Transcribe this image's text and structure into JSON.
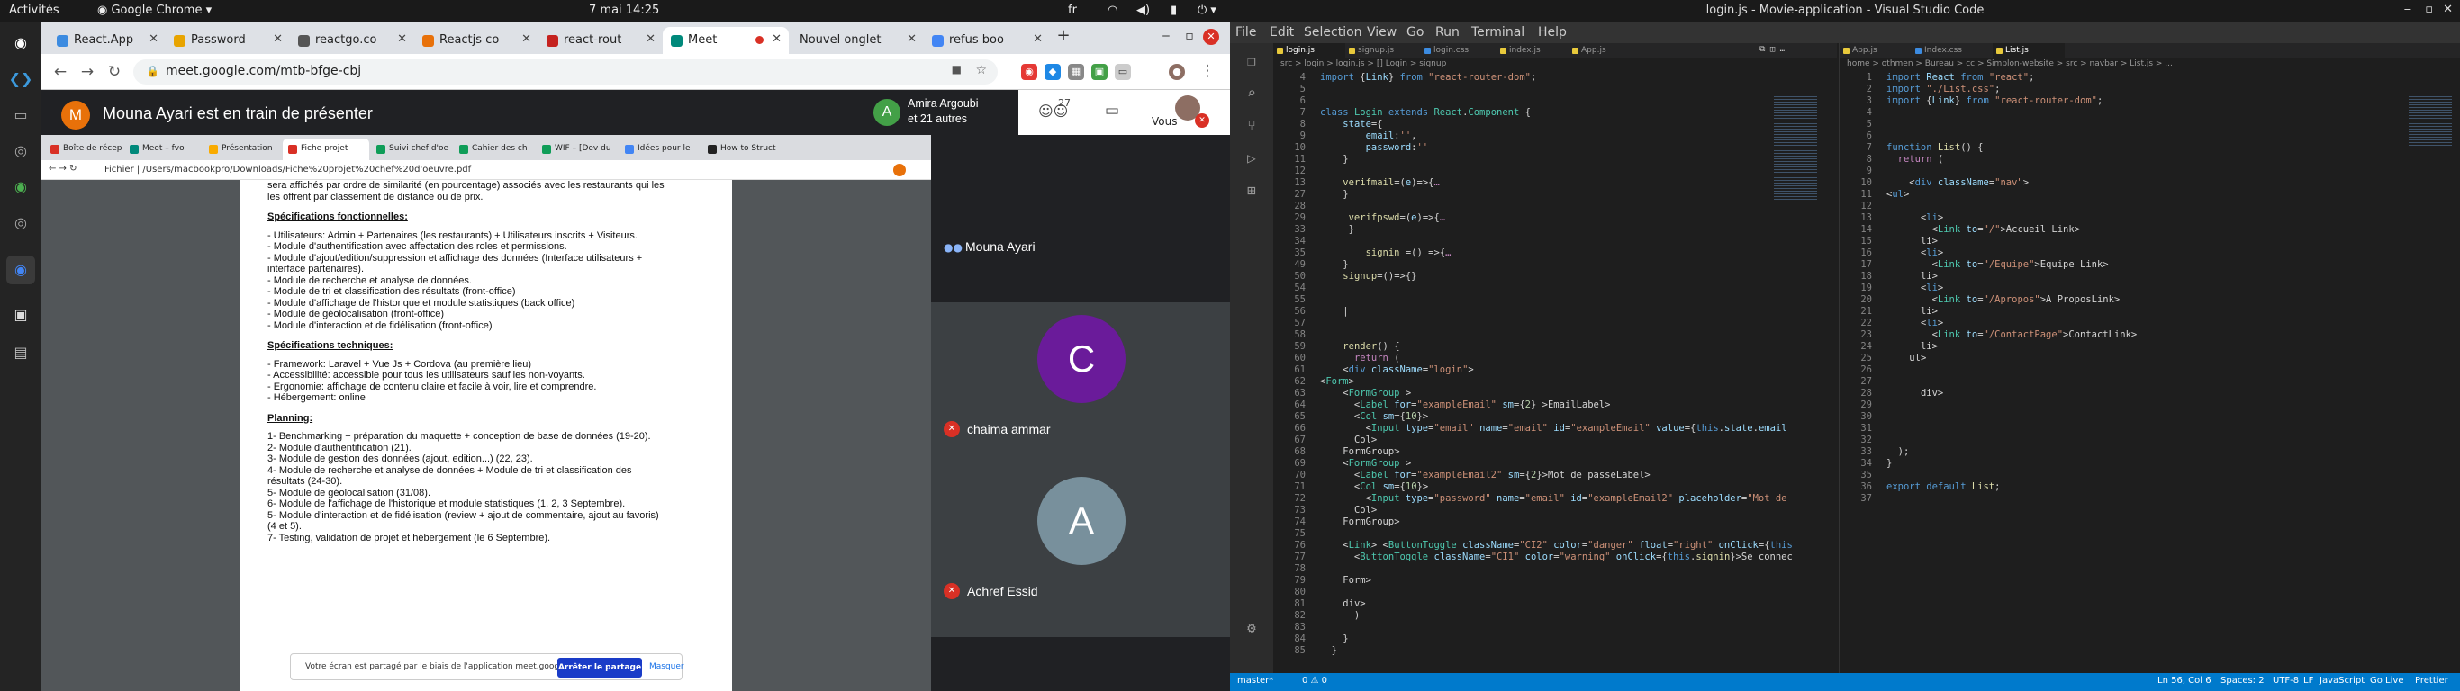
{
  "left": {
    "topbar": {
      "activities": "Activités",
      "app": "Google Chrome",
      "clock": "7 mai  14:25",
      "lang": "fr"
    },
    "tabs": [
      {
        "label": "React.App",
        "color": "#3c8be0"
      },
      {
        "label": "Password",
        "color": "#e8a400"
      },
      {
        "label": "reactgo.co",
        "color": "#555555"
      },
      {
        "label": "Reactjs co",
        "color": "#e8710a"
      },
      {
        "label": "react-rout",
        "color": "#c5221f"
      },
      {
        "label": "Meet –",
        "color": "#00897b"
      },
      {
        "label": "Nouvel onglet",
        "color": "#dee1e6"
      },
      {
        "label": "refus boo",
        "color": "#4285f4"
      }
    ],
    "url": "meet.google.com/mtb-bfge-cbj",
    "meet": {
      "presenter_initial": "M",
      "presenter_banner": "Mouna Ayari est en train de présenter",
      "viewer_initial": "A",
      "viewer_name": "Amira Argoubi",
      "viewer_others": "et 21 autres",
      "participants_count": "27",
      "you_label": "Vous"
    },
    "inner_tabs": [
      "Boîte de récep",
      "Meet – fvo",
      "Présentation",
      "Fiche projet",
      "Suivi chef d'oe",
      "Cahier des ch",
      "WIF – [Dev du",
      "Idées pour le",
      "How to Struct"
    ],
    "inner_url": "Fichier  |  /Users/macbookpro/Downloads/Fiche%20projet%20chef%20d'oeuvre.pdf",
    "pdf": {
      "intro": [
        "sera affichés par ordre de similarité (en pourcentage) associés avec les restaurants qui les",
        "les offrent par classement de distance ou de prix."
      ],
      "spec_fonc_title": "Spécifications fonctionnelles:",
      "spec_fonc": [
        "- Utilisateurs: Admin + Partenaires (les restaurants) + Utilisateurs inscrits + Visiteurs.",
        "- Module d'authentification avec affectation des roles et permissions.",
        "- Module d'ajout/edition/suppression et affichage des données (Interface utilisateurs +",
        "interface partenaires).",
        "- Module de recherche et analyse de données.",
        "- Module de tri et classification des résultats (front-office)",
        "- Module d'affichage de l'historique et module statistiques (back office)",
        "- Module de géolocalisation (front-office)",
        "- Module d'interaction et de fidélisation (front-office)"
      ],
      "spec_tech_title": "Spécifications techniques:",
      "spec_tech": [
        "- Framework: Laravel + Vue Js + Cordova (au première lieu)",
        "- Accessibilité: accessible pour tous les utilisateurs sauf les non-voyants.",
        "- Ergonomie: affichage de contenu claire et facile à voir, lire et comprendre.",
        "- Hébergement: online"
      ],
      "planning_title": "Planning:",
      "planning": [
        "1- Benchmarking + préparation du maquette + conception de base de données (19-20).",
        "2- Module d'authentification (21).",
        "3- Module de gestion des données (ajout, edition...) (22, 23).",
        "4- Module de recherche et analyse de données + Module de tri et classification des",
        "résultats (24-30).",
        "5- Module de géolocalisation (31/08).",
        "6- Module de l'affichage de l'historique et module statistiques (1, 2, 3 Septembre).",
        "5- Module d'interaction et de fidélisation (review + ajout de commentaire, ajout au favoris)",
        "(4 et 5).",
        "7- Testing, validation de projet et hébergement (le 6 Septembre)."
      ],
      "share_text": "Votre écran est partagé par le biais de l'application meet.google.com.",
      "stop_label": "Arrêter le partage",
      "hide_label": "Masquer"
    },
    "participants": [
      {
        "name": "Mouna Ayari",
        "initial": "",
        "color": ""
      },
      {
        "name": "chaima ammar",
        "initial": "C",
        "color": "#6a1b9a"
      },
      {
        "name": "Achref Essid",
        "initial": "A",
        "color": "#78909c"
      }
    ]
  },
  "right": {
    "title": "login.js - Movie-application - Visual Studio Code",
    "menu": [
      "File",
      "Edit",
      "Selection",
      "View",
      "Go",
      "Run",
      "Terminal",
      "Help"
    ],
    "left_tabs": [
      {
        "label": "login.js",
        "color": "#e8c93b"
      },
      {
        "label": "signup.js",
        "color": "#e8c93b"
      },
      {
        "label": "login.css",
        "color": "#3c8be0"
      },
      {
        "label": "index.js",
        "color": "#e8c93b"
      },
      {
        "label": "App.js",
        "color": "#e8c93b"
      }
    ],
    "left_breadcrumb": "src > login > login.js > [] Login > signup",
    "right_tabs": [
      {
        "label": "App.js",
        "color": "#e8c93b"
      },
      {
        "label": "Index.css",
        "color": "#3c8be0"
      },
      {
        "label": "List.js",
        "color": "#e8c93b"
      }
    ],
    "right_breadcrumb": "home > othmen > Bureau > cc > Simplon-website > src > navbar > List.js > ...",
    "left_code": [
      {
        "n": "4",
        "h": "<span class=k>import</span> {<span class=v>Link</span>} <span class=k>from</span> <span class=s>\"react-router-dom\"</span>;"
      },
      {
        "n": "5",
        "h": ""
      },
      {
        "n": "6",
        "h": ""
      },
      {
        "n": "7",
        "h": "<span class=k>class</span> <span class=t>Login</span> <span class=k>extends</span> <span class=t>React</span>.<span class=t>Component</span> {"
      },
      {
        "n": "8",
        "h": "    <span class=v>state</span>={"
      },
      {
        "n": "9",
        "h": "        <span class=v>email</span>:<span class=s>''</span>,"
      },
      {
        "n": "10",
        "h": "        <span class=v>password</span>:<span class=s>''</span>"
      },
      {
        "n": "11",
        "h": "    }"
      },
      {
        "n": "12",
        "h": ""
      },
      {
        "n": "13",
        "h": "    <span class=f>verifmail</span>=(<span class=v>e</span>)=>{<span class=p>…</span>"
      },
      {
        "n": "27",
        "h": "    }"
      },
      {
        "n": "28",
        "h": ""
      },
      {
        "n": "29",
        "h": "     <span class=f>verifpswd</span>=(<span class=v>e</span>)=>{<span class=p>…</span>"
      },
      {
        "n": "33",
        "h": "     }"
      },
      {
        "n": "34",
        "h": ""
      },
      {
        "n": "35",
        "h": "        <span class=f>signin</span> =() =>{<span class=p>…</span>"
      },
      {
        "n": "49",
        "h": "    }"
      },
      {
        "n": "50",
        "h": "    <span class=f>signup</span>=()=>{}"
      },
      {
        "n": "54",
        "h": ""
      },
      {
        "n": "55",
        "h": ""
      },
      {
        "n": "56",
        "h": "    |"
      },
      {
        "n": "57",
        "h": ""
      },
      {
        "n": "58",
        "h": ""
      },
      {
        "n": "59",
        "h": "    <span class=f>render</span>() {"
      },
      {
        "n": "60",
        "h": "      <span class=p>return</span> ("
      },
      {
        "n": "61",
        "h": "    <<span class=tg>div</span> <span class=ta>className</span>=<span class=s>\"login\"</span>>"
      },
      {
        "n": "62",
        "h": "<<span class=t>Form</span>>"
      },
      {
        "n": "63",
        "h": "    <<span class=t>FormGroup</span> >"
      },
      {
        "n": "64",
        "h": "      <<span class=t>Label</span> <span class=ta>for</span>=<span class=s>\"exampleEmail\"</span> <span class=ta>sm</span>={<span class=n>2</span>} >Email</<span class=t>Label</span>>"
      },
      {
        "n": "65",
        "h": "      <<span class=t>Col</span> <span class=ta>sm</span>={<span class=n>10</span>}>"
      },
      {
        "n": "66",
        "h": "        <<span class=t>Input</span> <span class=ta>type</span>=<span class=s>\"email\"</span> <span class=ta>name</span>=<span class=s>\"email\"</span> <span class=ta>id</span>=<span class=s>\"exampleEmail\"</span> <span class=ta>value</span>={<span class=k>this</span>.<span class=v>state</span>.<span class=v>email</span>"
      },
      {
        "n": "67",
        "h": "      </<span class=t>Col</span>>"
      },
      {
        "n": "68",
        "h": "    </<span class=t>FormGroup</span>>"
      },
      {
        "n": "69",
        "h": "    <<span class=t>FormGroup</span> >"
      },
      {
        "n": "70",
        "h": "      <<span class=t>Label</span> <span class=ta>for</span>=<span class=s>\"exampleEmail2\"</span> <span class=ta>sm</span>={<span class=n>2</span>}>Mot de passe</<span class=t>Label</span>>"
      },
      {
        "n": "71",
        "h": "      <<span class=t>Col</span> <span class=ta>sm</span>={<span class=n>10</span>}>"
      },
      {
        "n": "72",
        "h": "        <<span class=t>Input</span> <span class=ta>type</span>=<span class=s>\"password\"</span> <span class=ta>name</span>=<span class=s>\"email\"</span> <span class=ta>id</span>=<span class=s>\"exampleEmail2\"</span> <span class=ta>placeholder</span>=<span class=s>\"Mot de</span>"
      },
      {
        "n": "73",
        "h": "      </<span class=t>Col</span>>"
      },
      {
        "n": "74",
        "h": "    </<span class=t>FormGroup</span>>"
      },
      {
        "n": "75",
        "h": ""
      },
      {
        "n": "76",
        "h": "    <<span class=t>Link</span>> <<span class=t>ButtonToggle</span> <span class=ta>className</span>=<span class=s>\"CI2\"</span> <span class=ta>color</span>=<span class=s>\"danger\"</span> <span class=ta>float</span>=<span class=s>\"right\"</span> <span class=ta>onClick</span>={<span class=k>this</span>"
      },
      {
        "n": "77",
        "h": "      <<span class=t>ButtonToggle</span> <span class=ta>className</span>=<span class=s>\"CI1\"</span> <span class=ta>color</span>=<span class=s>\"warning\"</span> <span class=ta>onClick</span>={<span class=k>this</span>.<span class=f>signin</span>}>Se connec"
      },
      {
        "n": "78",
        "h": ""
      },
      {
        "n": "79",
        "h": "    </<span class=t>Form</span>>"
      },
      {
        "n": "80",
        "h": ""
      },
      {
        "n": "81",
        "h": "    </<span class=tg>div</span>>"
      },
      {
        "n": "82",
        "h": "      )"
      },
      {
        "n": "83",
        "h": ""
      },
      {
        "n": "84",
        "h": "    }"
      },
      {
        "n": "85",
        "h": "  }"
      }
    ],
    "right_code": [
      {
        "n": "1",
        "h": "<span class=k>import</span> <span class=v>React</span> <span class=k>from</span> <span class=s>\"react\"</span>;"
      },
      {
        "n": "2",
        "h": "<span class=k>import</span> <span class=s>\"./List.css\"</span>;"
      },
      {
        "n": "3",
        "h": "<span class=k>import</span> {<span class=v>Link</span>} <span class=k>from</span> <span class=s>\"react-router-dom\"</span>;"
      },
      {
        "n": "4",
        "h": ""
      },
      {
        "n": "5",
        "h": ""
      },
      {
        "n": "6",
        "h": ""
      },
      {
        "n": "7",
        "h": "<span class=k>function</span> <span class=f>List</span>() {"
      },
      {
        "n": "8",
        "h": "  <span class=p>return</span> ("
      },
      {
        "n": "9",
        "h": ""
      },
      {
        "n": "10",
        "h": "    <<span class=tg>div</span> <span class=ta>className</span>=<span class=s>\"nav\"</span>>"
      },
      {
        "n": "11",
        "h": "<<span class=tg>ul</span>>"
      },
      {
        "n": "12",
        "h": ""
      },
      {
        "n": "13",
        "h": "      <<span class=tg>li</span>>"
      },
      {
        "n": "14",
        "h": "        <<span class=t>Link</span> <span class=ta>to</span>=<span class=s>\"/\"</span>>Accueil </<span class=t>Link</span>>"
      },
      {
        "n": "15",
        "h": "      </<span class=tg>li</span>>"
      },
      {
        "n": "16",
        "h": "      <<span class=tg>li</span>>"
      },
      {
        "n": "17",
        "h": "        <<span class=t>Link</span> <span class=ta>to</span>=<span class=s>\"/Equipe\"</span>>Equipe </<span class=t>Link</span>>"
      },
      {
        "n": "18",
        "h": "      </<span class=tg>li</span>>"
      },
      {
        "n": "19",
        "h": "      <<span class=tg>li</span>>"
      },
      {
        "n": "20",
        "h": "        <<span class=t>Link</span> <span class=ta>to</span>=<span class=s>\"/Apropos\"</span>>A Propos</<span class=t>Link</span>>"
      },
      {
        "n": "21",
        "h": "      </<span class=tg>li</span>>"
      },
      {
        "n": "22",
        "h": "      <<span class=tg>li</span>>"
      },
      {
        "n": "23",
        "h": "        <<span class=t>Link</span> <span class=ta>to</span>=<span class=s>\"/ContactPage\"</span>>Contact</<span class=t>Link</span>>"
      },
      {
        "n": "24",
        "h": "      </<span class=tg>li</span>>"
      },
      {
        "n": "25",
        "h": "    </<span class=tg>ul</span>>"
      },
      {
        "n": "26",
        "h": ""
      },
      {
        "n": "27",
        "h": ""
      },
      {
        "n": "28",
        "h": "      </<span class=tg>div</span>>"
      },
      {
        "n": "29",
        "h": ""
      },
      {
        "n": "30",
        "h": ""
      },
      {
        "n": "31",
        "h": ""
      },
      {
        "n": "32",
        "h": ""
      },
      {
        "n": "33",
        "h": "  );"
      },
      {
        "n": "34",
        "h": "}"
      },
      {
        "n": "35",
        "h": ""
      },
      {
        "n": "36",
        "h": "<span class=k>export</span> <span class=k>default</span> <span class=f>List</span>;"
      },
      {
        "n": "37",
        "h": ""
      }
    ],
    "status_left": [
      "master*",
      "0 ⚠ 0"
    ],
    "status_right": [
      "Ln 56, Col 6",
      "Spaces: 2",
      "UTF-8",
      "LF",
      "JavaScript",
      "Go Live",
      "Prettier"
    ]
  }
}
